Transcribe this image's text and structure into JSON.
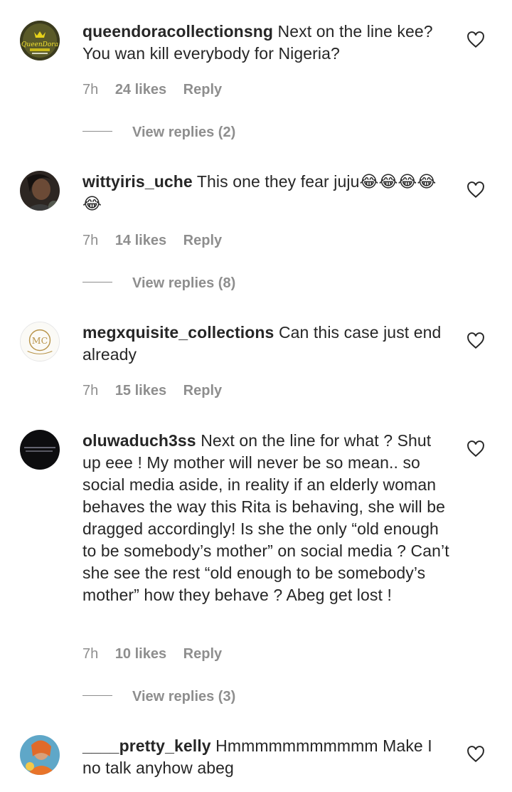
{
  "comments": [
    {
      "username": "queendoracollectionsng",
      "text": "Next on the line kee? You wan kill everybody for Nigeria?",
      "time": "7h",
      "likes": "24 likes",
      "reply": "Reply",
      "view_replies": "View replies (2)",
      "avatar_logo_text": "QueenDora"
    },
    {
      "username": "wittyiris_uche",
      "text": "This one they fear juju😂😂😂😂😂",
      "time": "7h",
      "likes": "14 likes",
      "reply": "Reply",
      "view_replies": "View replies (8)"
    },
    {
      "username": "megxquisite_collections",
      "text": "Can this case just end already",
      "time": "7h",
      "likes": "15 likes",
      "reply": "Reply",
      "avatar_logo_text": "MC"
    },
    {
      "username": "oluwaduch3ss",
      "text": "Next on the line for what ? Shut up eee ! My mother will never be so mean.. so social media aside, in reality if an elderly woman behaves the way this Rita is behaving, she will be dragged accordingly! Is she the only “old enough to be somebody’s mother” on social media ? Can’t she see the rest “old enough to be somebody’s mother” how they behave ? Abeg get lost !",
      "time": "7h",
      "likes": "10 likes",
      "reply": "Reply",
      "view_replies": "View replies (3)"
    },
    {
      "username": "____pretty_kelly",
      "text": "Hmmmmmmmmmmm Make I no talk anyhow abeg"
    }
  ],
  "colors": {
    "text": "#262626",
    "muted": "#8e8e8e",
    "background": "#ffffff"
  }
}
